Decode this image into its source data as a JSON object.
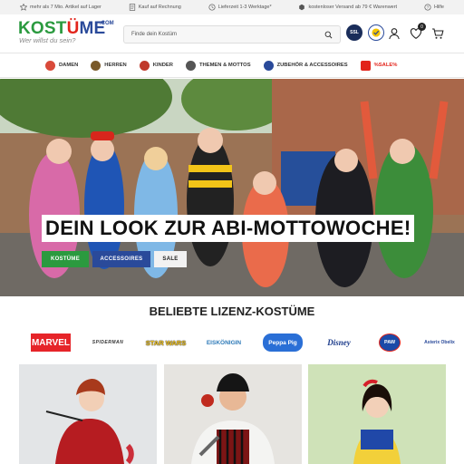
{
  "topbar": {
    "items": [
      {
        "icon": "star-icon",
        "text": "mehr als 7 Mio. Artikel auf Lager"
      },
      {
        "icon": "invoice-icon",
        "text": "Kauf auf Rechnung"
      },
      {
        "icon": "clock-icon",
        "text": "Lieferzeit 1-3 Werktage*"
      },
      {
        "icon": "truck-icon",
        "text": "kostenloser Versand ab 79 € Warenwert"
      },
      {
        "icon": "help-icon",
        "text": "Hilfe"
      }
    ]
  },
  "header": {
    "logo_k": "KOST",
    "logo_u": "Ü",
    "logo_me": "ME",
    "logo_domain": ".COM",
    "tagline": "Wer willst du sein?",
    "search_placeholder": "Finde dein Kostüm",
    "badge_ssl": "SSL",
    "wishlist_count": "0"
  },
  "nav": {
    "items": [
      {
        "label": "DAMEN",
        "icon": "damen-icon",
        "color": "#d94a3a"
      },
      {
        "label": "HERREN",
        "icon": "herren-icon",
        "color": "#7a5a2a"
      },
      {
        "label": "KINDER",
        "icon": "kinder-icon",
        "color": "#c0392b"
      },
      {
        "label": "THEMEN & MOTTOS",
        "icon": "themen-icon",
        "color": "#555555"
      },
      {
        "label": "ZUBEHÖR & ACCESSOIRES",
        "icon": "zubehoer-icon",
        "color": "#2a4a9a"
      },
      {
        "label": "%SALE%",
        "icon": "sale-icon",
        "color": "#e2231a"
      }
    ]
  },
  "hero": {
    "title": "DEIN LOOK ZUR ABI-MOTTOWOCHE!",
    "buttons": [
      {
        "label": "KOSTÜME",
        "bg": "#2b9a3f",
        "fg": "#ffffff"
      },
      {
        "label": "ACCESSOIRES",
        "bg": "#2a4a9a",
        "fg": "#ffffff"
      },
      {
        "label": "SALE",
        "bg": "#f2f2f2",
        "fg": "#222222"
      }
    ]
  },
  "brands": {
    "title": "BELIEBTE LIZENZ-KOSTÜME",
    "items": [
      "MARVEL",
      "SPIDERMAN",
      "STAR WARS",
      "EISKÖNIGIN",
      "Peppa Pig",
      "Disney",
      "PAW",
      "Asterix Obelix"
    ]
  },
  "colors": {
    "green": "#2b9a3f",
    "blue": "#2a4a9a",
    "red": "#e2231a"
  }
}
